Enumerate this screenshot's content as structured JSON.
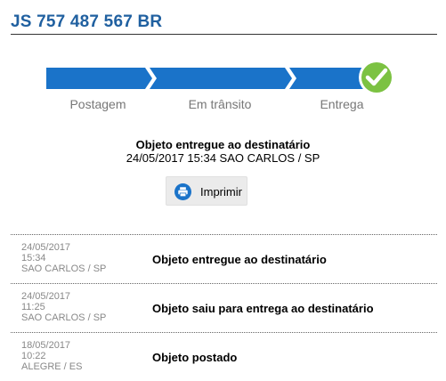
{
  "tracking": {
    "code": "JS 757 487 567 BR"
  },
  "progress": {
    "steps": [
      "Postagem",
      "Em trânsito",
      "Entrega"
    ],
    "completed_steps": 3,
    "colors": {
      "bar": "#1a73c9",
      "check": "#7cc242"
    }
  },
  "status": {
    "title": "Objeto entregue ao destinatário",
    "detail": "24/05/2017 15:34 SAO CARLOS / SP"
  },
  "print": {
    "label": "Imprimir",
    "icon": "printer-icon"
  },
  "events": [
    {
      "date": "24/05/2017",
      "time": "15:34",
      "location": "SAO CARLOS / SP",
      "description": "Objeto entregue ao destinatário"
    },
    {
      "date": "24/05/2017",
      "time": "11:25",
      "location": "SAO CARLOS / SP",
      "description": "Objeto saiu para entrega ao destinatário"
    },
    {
      "date": "18/05/2017",
      "time": "10:22",
      "location": "ALEGRE / ES",
      "description": "Objeto postado"
    }
  ]
}
